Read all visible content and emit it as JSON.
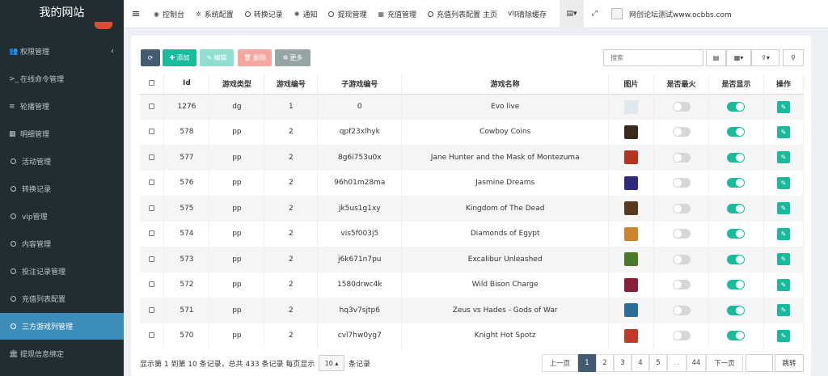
{
  "sidebar": {
    "logo": "我的网站",
    "items": [
      {
        "label": "权限管理",
        "icon": "users-icon"
      },
      {
        "label": "在线命令管理",
        "icon": "terminal-icon"
      },
      {
        "label": "轮播管理",
        "icon": "bars-icon"
      },
      {
        "label": "明细管理",
        "icon": "calendar-icon"
      },
      {
        "label": "活动管理",
        "icon": "circle-icon"
      },
      {
        "label": "转换记录",
        "icon": "circle-icon"
      },
      {
        "label": "vip管理",
        "icon": "circle-icon"
      },
      {
        "label": "内容管理",
        "icon": "circle-icon"
      },
      {
        "label": "投注记录管理",
        "icon": "circle-icon"
      },
      {
        "label": "充值列表配置",
        "icon": "circle-icon"
      },
      {
        "label": "三方游戏列管理",
        "icon": "circle-icon"
      },
      {
        "label": "提现信息绑定",
        "icon": "bank-icon"
      }
    ]
  },
  "topbar": {
    "menu_icon": "≡",
    "items": [
      "控制台",
      "系统配置",
      "转换记录",
      "通知",
      "提现管理",
      "充值管理",
      "充值列表配置",
      "主页",
      "vip",
      "清除缓存"
    ],
    "user": "网创论坛测试www.ocbbs.com"
  },
  "toolbar": {
    "add": "添加",
    "edit": "编辑",
    "delete": "删除",
    "more": "更多",
    "search_placeholder": "搜索"
  },
  "table": {
    "headers": [
      "Id",
      "游戏类型",
      "游戏编号",
      "子游戏编号",
      "游戏名称",
      "图片",
      "是否最火",
      "是否显示",
      "操作"
    ],
    "rows": [
      {
        "id": "1276",
        "type": "dg",
        "num": "1",
        "sub": "0",
        "name": "Evo live",
        "hot": false,
        "show": true,
        "thumb": "#dfe7ef"
      },
      {
        "id": "578",
        "type": "pp",
        "num": "2",
        "sub": "qpf23xlhyk",
        "name": "Cowboy Coins",
        "hot": false,
        "show": true,
        "thumb": "#3b2a1e"
      },
      {
        "id": "577",
        "type": "pp",
        "num": "2",
        "sub": "8g6i753u0x",
        "name": "Jane Hunter and the Mask of Montezuma",
        "hot": false,
        "show": true,
        "thumb": "#b2361f"
      },
      {
        "id": "576",
        "type": "pp",
        "num": "2",
        "sub": "96h01m28ma",
        "name": "Jasmine Dreams",
        "hot": false,
        "show": true,
        "thumb": "#2d2b7a"
      },
      {
        "id": "575",
        "type": "pp",
        "num": "2",
        "sub": "jk5us1g1xy",
        "name": "Kingdom of The Dead",
        "hot": false,
        "show": true,
        "thumb": "#5a3a1e"
      },
      {
        "id": "574",
        "type": "pp",
        "num": "2",
        "sub": "vis5f003j5",
        "name": "Diamonds of Egypt",
        "hot": false,
        "show": true,
        "thumb": "#c9842c"
      },
      {
        "id": "573",
        "type": "pp",
        "num": "2",
        "sub": "j6k671n7pu",
        "name": "Excalibur Unleashed",
        "hot": false,
        "show": true,
        "thumb": "#4b7b2a"
      },
      {
        "id": "572",
        "type": "pp",
        "num": "2",
        "sub": "1580drwc4k",
        "name": "Wild Bison Charge",
        "hot": false,
        "show": true,
        "thumb": "#8a1f3a"
      },
      {
        "id": "571",
        "type": "pp",
        "num": "2",
        "sub": "hq3v7sjtp6",
        "name": "Zeus vs Hades - Gods of War",
        "hot": false,
        "show": true,
        "thumb": "#2a6f9a"
      },
      {
        "id": "570",
        "type": "pp",
        "num": "2",
        "sub": "cvl7hw0yg7",
        "name": "Knight Hot Spotz",
        "hot": false,
        "show": true,
        "thumb": "#c23a2a"
      }
    ]
  },
  "footer": {
    "summary": "显示第 1 到第 10 条记录，总共 433 条记录 每页显示",
    "page_size": "10 ▴",
    "suffix": "条记录",
    "prev": "上一页",
    "pages": [
      "1",
      "2",
      "3",
      "4",
      "5",
      "...",
      "44"
    ],
    "next": "下一页",
    "jump": "跳转"
  },
  "colors": {
    "accent": "#18bc9c",
    "sidebar": "#222d32",
    "active": "#3c8dbc",
    "dark_btn": "#445a71"
  }
}
